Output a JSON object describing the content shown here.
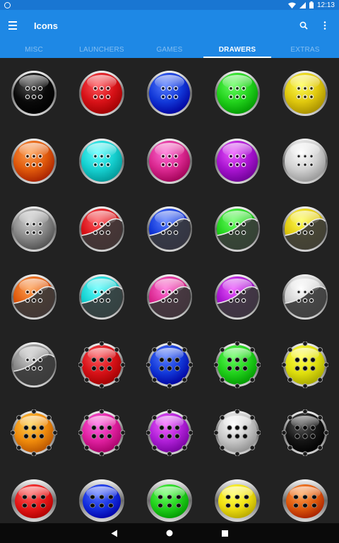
{
  "status": {
    "time": "12:13"
  },
  "app_bar": {
    "title": "Icons"
  },
  "tabs": [
    {
      "label": "MISC",
      "active": false
    },
    {
      "label": "LAUNCHERS",
      "active": false
    },
    {
      "label": "GAMES",
      "active": false
    },
    {
      "label": "DRAWERS",
      "active": true
    },
    {
      "label": "EXTRAS",
      "active": false
    }
  ],
  "colors": {
    "app_bar": "#1e88e5",
    "status_bar": "#1976d2",
    "background": "#222222"
  },
  "icons": [
    {
      "style": "round",
      "color": "#0a0a0a",
      "half": false
    },
    {
      "style": "round",
      "color": "#d81218",
      "half": false
    },
    {
      "style": "round",
      "color": "#1238d8",
      "half": false
    },
    {
      "style": "round",
      "color": "#22d21c",
      "half": false
    },
    {
      "style": "round",
      "color": "#e0c80e",
      "half": false
    },
    {
      "style": "round",
      "color": "#e05a0c",
      "half": false
    },
    {
      "style": "round",
      "color": "#16d0d0",
      "half": false
    },
    {
      "style": "round",
      "color": "#da2890",
      "half": false
    },
    {
      "style": "round",
      "color": "#a814d0",
      "half": false
    },
    {
      "style": "round",
      "color": "#d0d0d0",
      "half": false
    },
    {
      "style": "round",
      "color": "#8a8a8a",
      "half": false
    },
    {
      "style": "round",
      "color": "#d81218",
      "half": true
    },
    {
      "style": "round",
      "color": "#1238d8",
      "half": true
    },
    {
      "style": "round",
      "color": "#22d21c",
      "half": true
    },
    {
      "style": "round",
      "color": "#e0c80e",
      "half": true
    },
    {
      "style": "round",
      "color": "#e05a0c",
      "half": true
    },
    {
      "style": "round",
      "color": "#16d0d0",
      "half": true
    },
    {
      "style": "round",
      "color": "#da2890",
      "half": true
    },
    {
      "style": "round",
      "color": "#a814d0",
      "half": true
    },
    {
      "style": "round",
      "color": "#d0d0d0",
      "half": true
    },
    {
      "style": "round",
      "color": "#8a8a8a",
      "half": true
    },
    {
      "style": "notched",
      "color": "#d81218",
      "half": false
    },
    {
      "style": "notched",
      "color": "#1238d8",
      "half": false
    },
    {
      "style": "notched",
      "color": "#22d21c",
      "half": false
    },
    {
      "style": "notched",
      "color": "#e0e00e",
      "half": false
    },
    {
      "style": "notched",
      "color": "#f08c0c",
      "half": false
    },
    {
      "style": "notched",
      "color": "#e020a0",
      "half": false
    },
    {
      "style": "notched",
      "color": "#b020d8",
      "half": false
    },
    {
      "style": "notched",
      "color": "#c8c8c8",
      "half": false
    },
    {
      "style": "notched",
      "color": "#151515",
      "half": false
    },
    {
      "style": "oval",
      "color": "#e81818",
      "half": false
    },
    {
      "style": "oval",
      "color": "#1430e0",
      "half": false
    },
    {
      "style": "oval",
      "color": "#22d21c",
      "half": false
    },
    {
      "style": "oval",
      "color": "#f0e010",
      "half": false
    },
    {
      "style": "oval",
      "color": "#e05a0c",
      "half": false
    }
  ]
}
